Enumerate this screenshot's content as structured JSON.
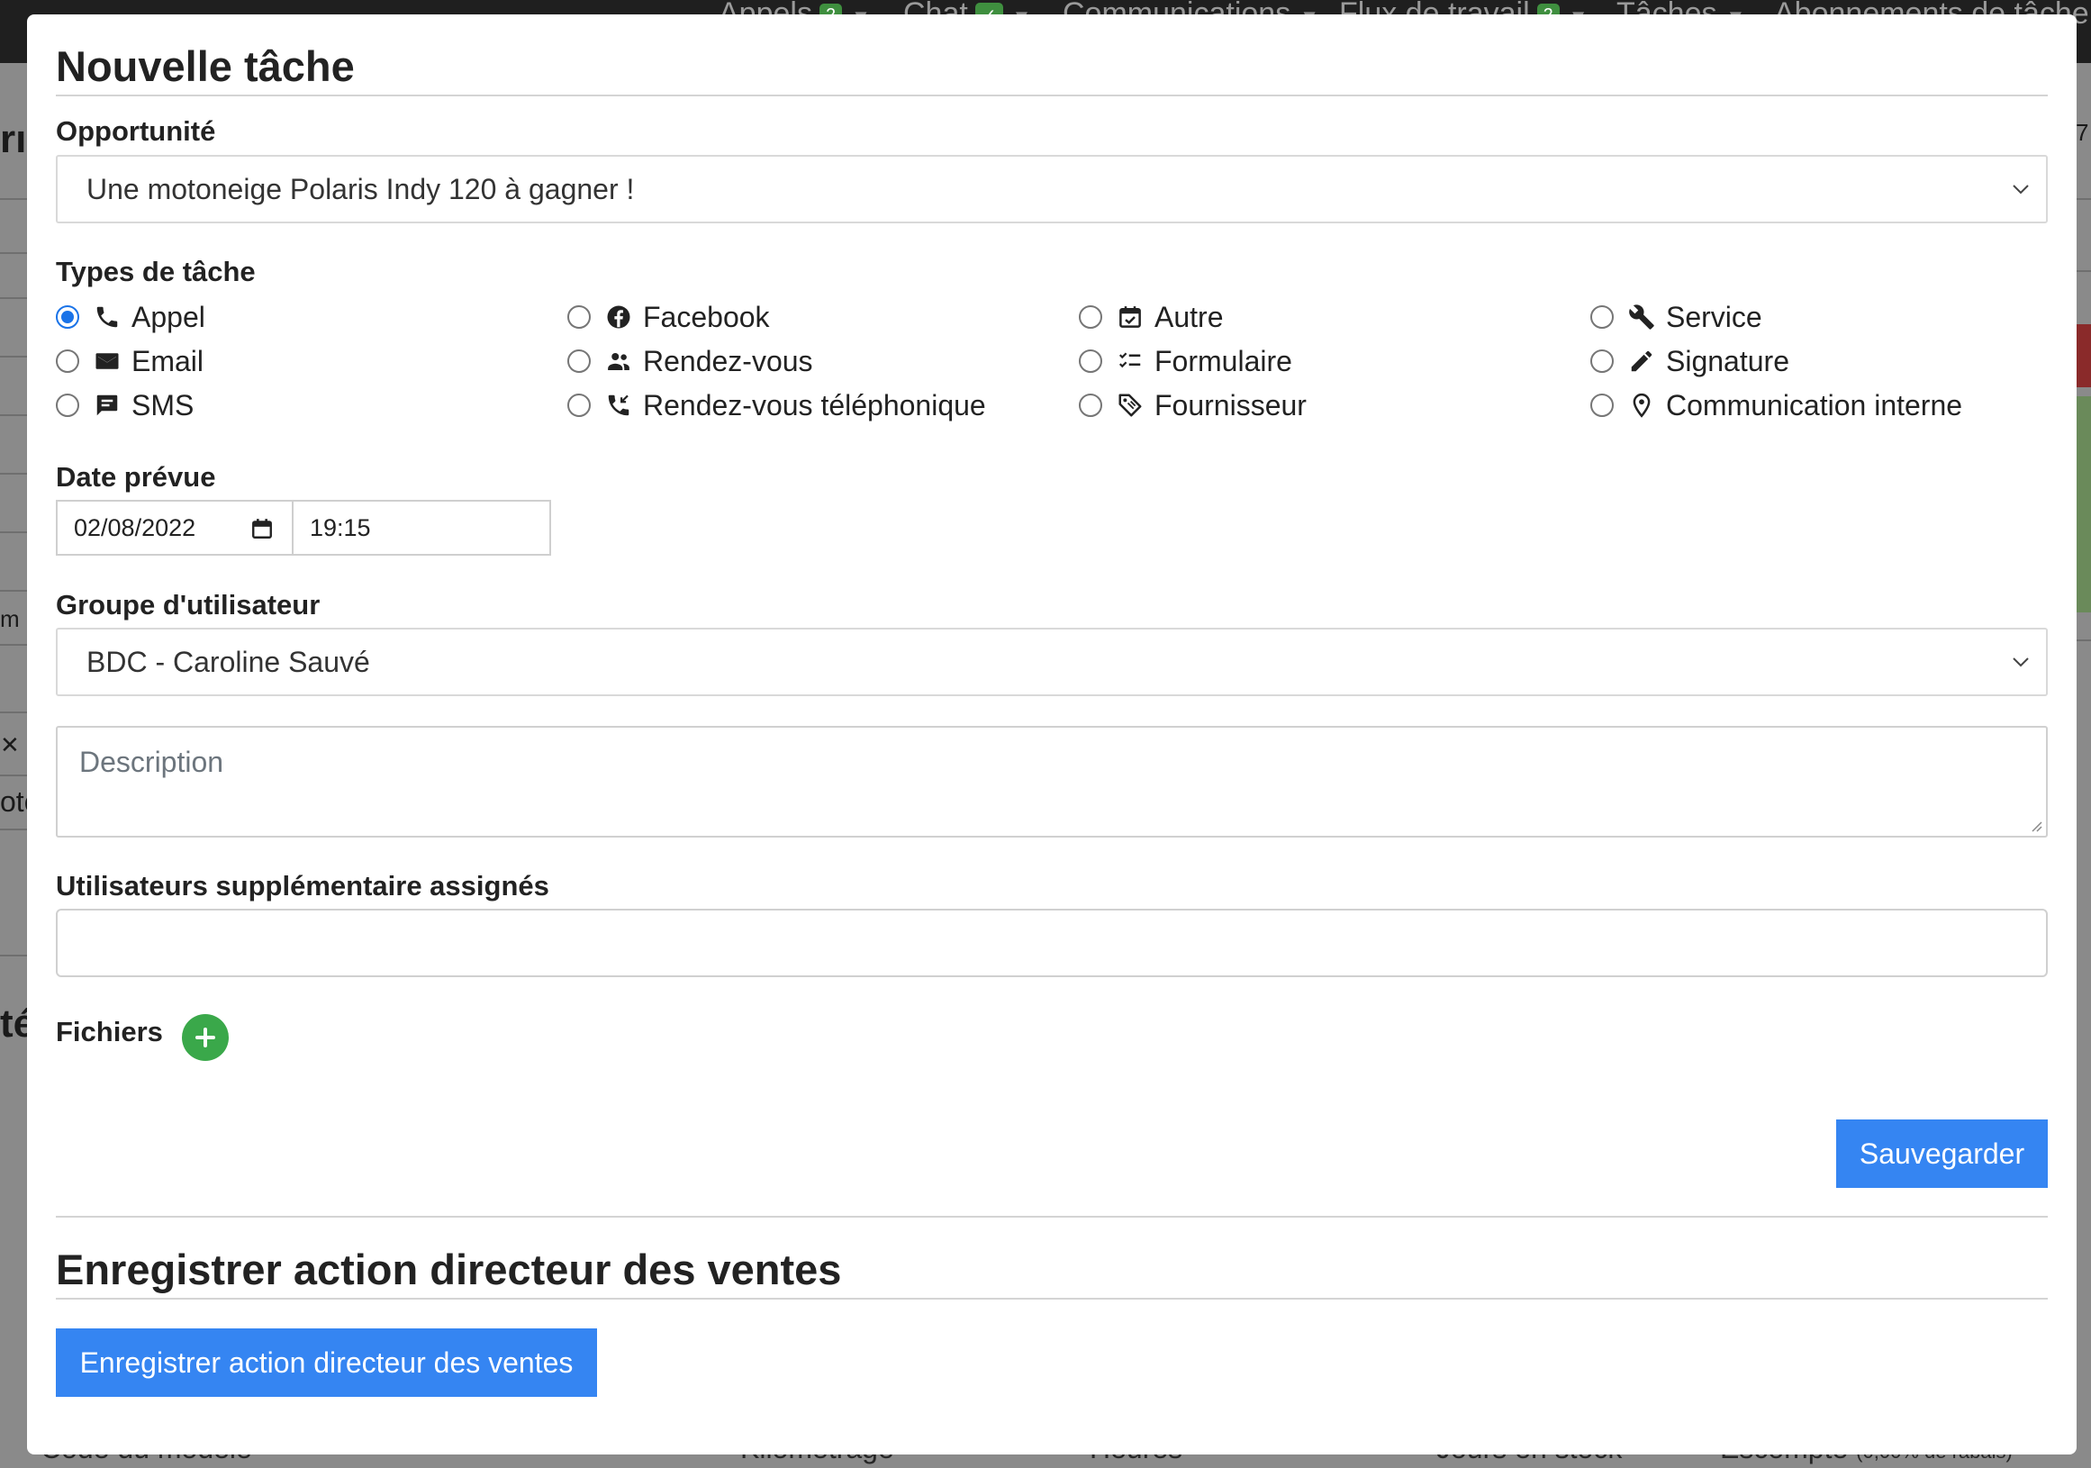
{
  "background": {
    "nav": [
      {
        "label": "Appels",
        "badge": "2"
      },
      {
        "label": "Chat",
        "badge": "✓"
      },
      {
        "label": "Communications",
        "badge": ""
      },
      {
        "label": "Flux de travail",
        "badge": "2"
      },
      {
        "label": "Tâches",
        "badge": ""
      },
      {
        "label": "Abonnements de tâche",
        "badge": ""
      }
    ],
    "fragments": [
      "rı",
      "7",
      "m",
      "✕ E",
      "oto",
      "té"
    ],
    "bottom_columns": [
      "Code du modèle",
      "Kilométrage",
      "Heures",
      "Jours en stock",
      "Escompte"
    ],
    "bottom_small": "(0,00% de rabais)"
  },
  "modal": {
    "title": "Nouvelle tâche",
    "opportunity": {
      "label": "Opportunité",
      "value": "Une motoneige Polaris Indy 120 à gagner !"
    },
    "task_types": {
      "label": "Types de tâche",
      "selected": "Appel",
      "options": [
        {
          "label": "Appel",
          "icon": "phone-icon"
        },
        {
          "label": "Email",
          "icon": "envelope-icon"
        },
        {
          "label": "SMS",
          "icon": "message-icon"
        },
        {
          "label": "Facebook",
          "icon": "facebook-icon"
        },
        {
          "label": "Rendez-vous",
          "icon": "people-icon"
        },
        {
          "label": "Rendez-vous téléphonique",
          "icon": "phone-callback-icon"
        },
        {
          "label": "Autre",
          "icon": "calendar-check-icon"
        },
        {
          "label": "Formulaire",
          "icon": "checklist-icon"
        },
        {
          "label": "Fournisseur",
          "icon": "tag-icon"
        },
        {
          "label": "Service",
          "icon": "wrench-icon"
        },
        {
          "label": "Signature",
          "icon": "pencil-icon"
        },
        {
          "label": "Communication interne",
          "icon": "map-pin-icon"
        }
      ]
    },
    "scheduled_date": {
      "label": "Date prévue",
      "date": "02/08/2022",
      "time": "19:15"
    },
    "user_group": {
      "label": "Groupe d'utilisateur",
      "value": "BDC - Caroline Sauvé"
    },
    "description": {
      "placeholder": "Description",
      "value": ""
    },
    "additional_users": {
      "label": "Utilisateurs supplémentaire assignés",
      "value": ""
    },
    "files": {
      "label": "Fichiers"
    },
    "save_label": "Sauvegarder",
    "sales_director": {
      "title": "Enregistrer action directeur des ventes",
      "button_label": "Enregistrer action directeur des ventes"
    }
  },
  "colors": {
    "primary": "#3585f2",
    "success": "#3aa84a",
    "radio_checked": "#1a73e8",
    "overlay": "#7c7c7c"
  }
}
